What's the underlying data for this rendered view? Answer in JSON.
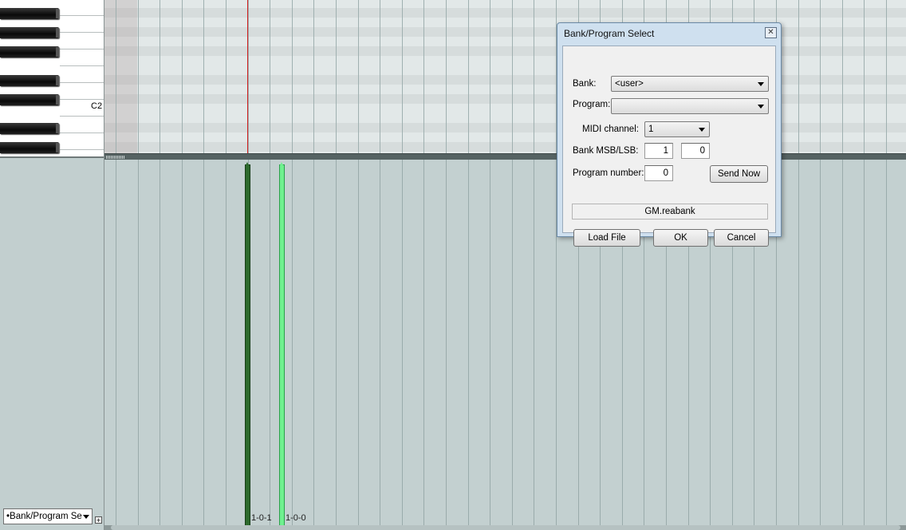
{
  "keyboard": {
    "note_label": "C2"
  },
  "timeline": {
    "events": [
      {
        "label": "1-0-1",
        "color": "#2d6a2d"
      },
      {
        "label": "1-0-0",
        "color": "#6ff08f"
      }
    ]
  },
  "lane": {
    "selector_value": "•Bank/Program Se",
    "add_symbol": "+"
  },
  "dialog": {
    "title": "Bank/Program Select",
    "close_symbol": "✕",
    "bank_label": "Bank:",
    "bank_value": "<user>",
    "program_label": "Program:",
    "program_value": "",
    "midi_channel_label": "MIDI channel:",
    "midi_channel_value": "1",
    "bank_msb_lsb_label": "Bank MSB/LSB:",
    "bank_msb_value": "1",
    "bank_lsb_value": "0",
    "program_number_label": "Program number:",
    "program_number_value": "0",
    "send_now_label": "Send Now",
    "bank_file": "GM.reabank",
    "load_file_label": "Load File",
    "ok_label": "OK",
    "cancel_label": "Cancel"
  },
  "colors": {
    "cursor": "#d42020",
    "lane_bg": "#c3d0d0",
    "dialog_frame": "#cfe0ef"
  }
}
